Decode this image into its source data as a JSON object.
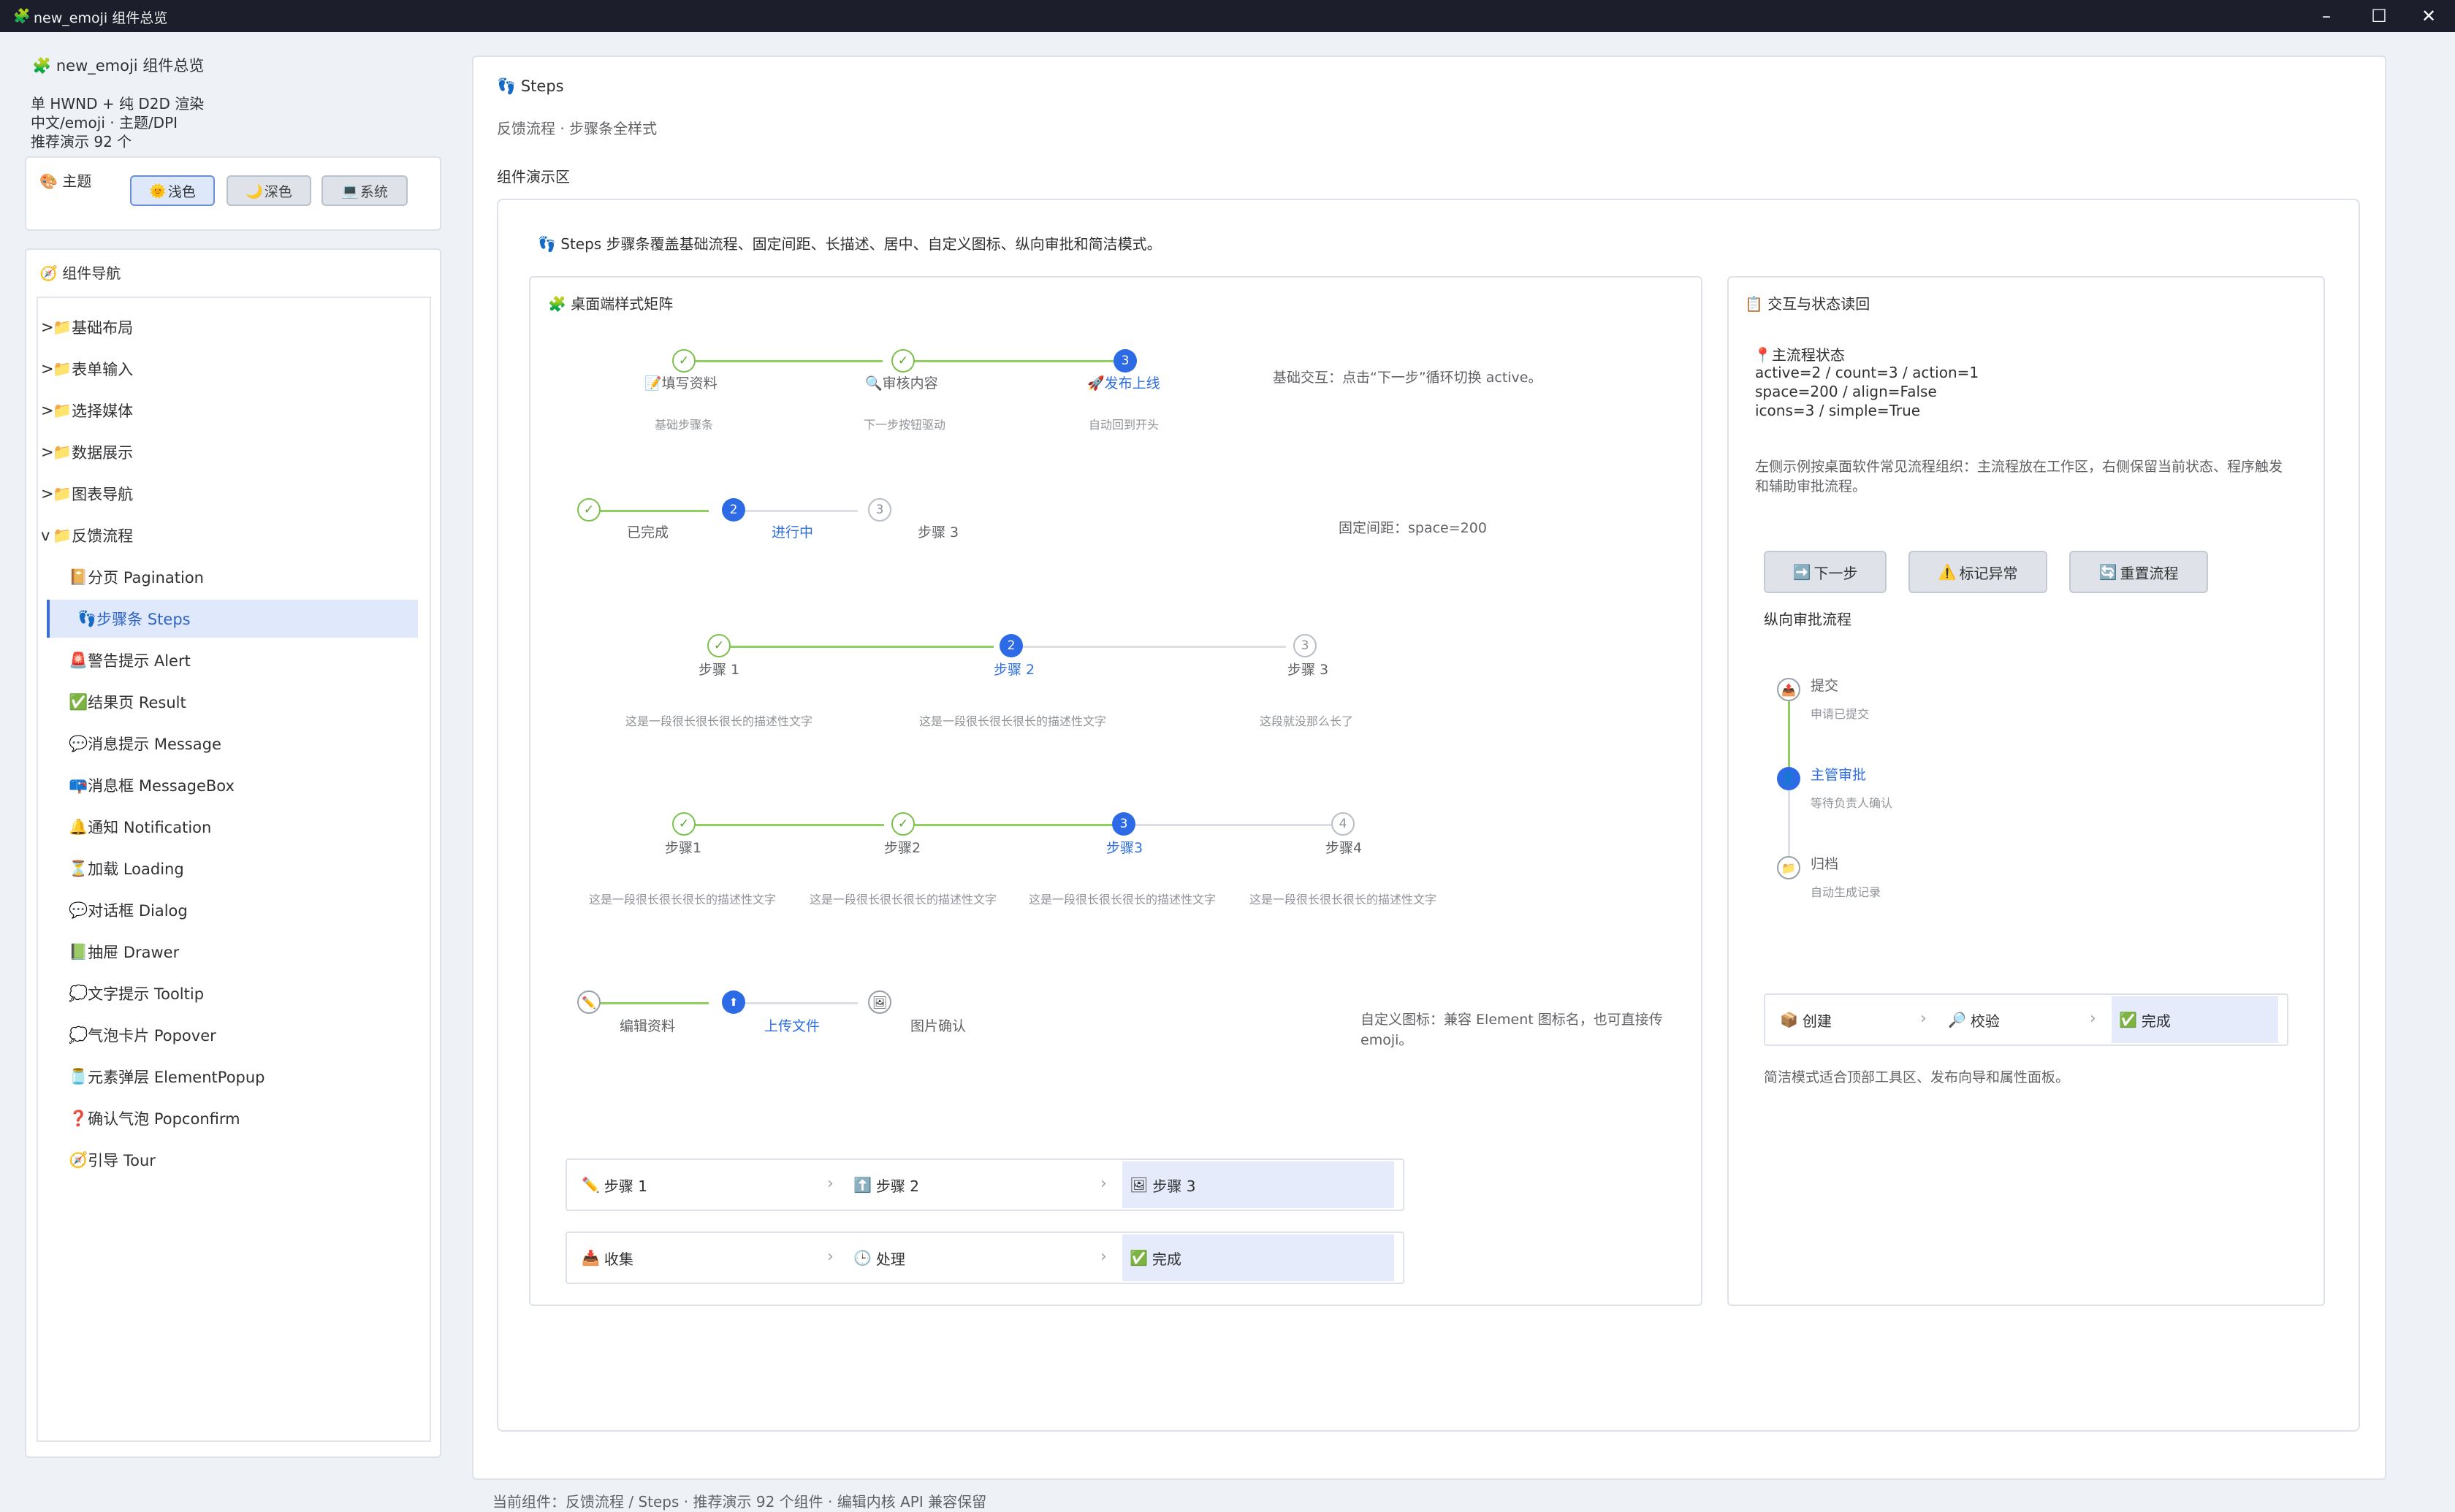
{
  "window": {
    "title": "new_emoji 组件总览",
    "icon": "🧩"
  },
  "sidebar": {
    "app_title": "new_emoji 组件总览",
    "info_lines": [
      "单 HWND + 纯 D2D 渲染",
      "中文/emoji · 主题/DPI",
      "推荐演示 92 个"
    ],
    "theme": {
      "title": "主题",
      "buttons": [
        {
          "icon": "🌞",
          "label": "浅色",
          "active": true
        },
        {
          "icon": "🌙",
          "label": "深色",
          "active": false
        },
        {
          "icon": "💻",
          "label": "系统",
          "active": false
        }
      ]
    },
    "nav": {
      "title": "组件导航",
      "items": [
        {
          "prefix": ">",
          "icon": "📁",
          "label": "基础布局"
        },
        {
          "prefix": ">",
          "icon": "📁",
          "label": "表单输入"
        },
        {
          "prefix": ">",
          "icon": "📁",
          "label": "选择媒体"
        },
        {
          "prefix": ">",
          "icon": "📁",
          "label": "数据展示"
        },
        {
          "prefix": ">",
          "icon": "📁",
          "label": "图表导航"
        },
        {
          "prefix": "v",
          "icon": "📁",
          "label": "反馈流程"
        },
        {
          "prefix": "",
          "icon": "📔",
          "label": "分页 Pagination"
        },
        {
          "prefix": "",
          "icon": "👣",
          "label": "步骤条 Steps",
          "selected": true
        },
        {
          "prefix": "",
          "icon": "🚨",
          "label": "警告提示 Alert"
        },
        {
          "prefix": "",
          "icon": "✅",
          "label": "结果页 Result"
        },
        {
          "prefix": "",
          "icon": "💬",
          "label": "消息提示 Message"
        },
        {
          "prefix": "",
          "icon": "📪",
          "label": "消息框 MessageBox"
        },
        {
          "prefix": "",
          "icon": "🔔",
          "label": "通知 Notification"
        },
        {
          "prefix": "",
          "icon": "⏳",
          "label": "加载 Loading"
        },
        {
          "prefix": "",
          "icon": "💬",
          "label": "对话框 Dialog"
        },
        {
          "prefix": "",
          "icon": "📗",
          "label": "抽屉 Drawer"
        },
        {
          "prefix": "",
          "icon": "💭",
          "label": "文字提示 Tooltip"
        },
        {
          "prefix": "",
          "icon": "💭",
          "label": "气泡卡片 Popover"
        },
        {
          "prefix": "",
          "icon": "🫙",
          "label": "元素弹层 ElementPopup"
        },
        {
          "prefix": "",
          "icon": "❓",
          "label": "确认气泡 Popconfirm"
        },
        {
          "prefix": "",
          "icon": "🧭",
          "label": "引导 Tour"
        }
      ]
    }
  },
  "main": {
    "title_icon": "👣",
    "title": "Steps",
    "subtitle": "反馈流程 · 步骤条全样式",
    "demo_label": "组件演示区",
    "intro": "Steps 步骤条覆盖基础流程、固定间距、长描述、居中、自定义图标、纵向审批和简洁模式。",
    "left_panel": {
      "title": "桌面端样式矩阵",
      "row1": {
        "steps": [
          {
            "icon": "📝",
            "title": "填写资料",
            "desc": "基础步骤条",
            "status": "done"
          },
          {
            "icon": "🔍",
            "title": "审核内容",
            "desc": "下一步按钮驱动",
            "status": "done"
          },
          {
            "icon": "🚀",
            "title": "发布上线",
            "desc": "自动回到开头",
            "status": "current",
            "num": "3"
          }
        ],
        "note": "基础交互：点击“下一步”循环切换 active。"
      },
      "row2": {
        "steps": [
          {
            "title": "已完成",
            "status": "done"
          },
          {
            "title": "进行中",
            "status": "current",
            "num": "2"
          },
          {
            "title": "步骤 3",
            "status": "wait",
            "num": "3"
          }
        ],
        "note": "固定间距：space=200"
      },
      "row3": {
        "steps": [
          {
            "title": "步骤 1",
            "desc": "这是一段很长很长很长的描述性文字",
            "status": "done"
          },
          {
            "title": "步骤 2",
            "desc": "这是一段很长很长很长的描述性文字",
            "status": "current",
            "num": "2"
          },
          {
            "title": "步骤 3",
            "desc": "这段就没那么长了",
            "status": "wait",
            "num": "3"
          }
        ]
      },
      "row4": {
        "steps": [
          {
            "title": "步骤1",
            "desc": "这是一段很长很长很长的描述性文字",
            "status": "done"
          },
          {
            "title": "步骤2",
            "desc": "这是一段很长很长很长的描述性文字",
            "status": "done"
          },
          {
            "title": "步骤3",
            "desc": "这是一段很长很长很长的描述性文字",
            "status": "current",
            "num": "3"
          },
          {
            "title": "步骤4",
            "desc": "这是一段很长很长很长的描述性文字",
            "status": "wait",
            "num": "4"
          }
        ]
      },
      "row5": {
        "steps": [
          {
            "icon": "✏️",
            "title": "编辑资料",
            "status": "done"
          },
          {
            "icon": "⬆",
            "title": "上传文件",
            "status": "current"
          },
          {
            "icon": "🖼",
            "title": "图片确认",
            "status": "wait"
          }
        ],
        "note": "自定义图标：兼容 Element 图标名，也可直接传 emoji。"
      },
      "simple1": [
        {
          "icon": "✏️",
          "label": "步骤 1"
        },
        {
          "icon": "⬆️",
          "label": "步骤 2"
        },
        {
          "icon": "🖼",
          "label": "步骤 3"
        }
      ],
      "simple2": [
        {
          "icon": "📥",
          "label": "收集"
        },
        {
          "icon": "🕒",
          "label": "处理"
        },
        {
          "icon": "✅",
          "label": "完成"
        }
      ]
    },
    "right_panel": {
      "title": "交互与状态读回",
      "status_title": "主流程状态",
      "status_lines": [
        "active=2 / count=3 / action=1",
        "space=200 / align=False",
        "icons=3 / simple=True"
      ],
      "desc": "左侧示例按桌面软件常见流程组织：主流程放在工作区，右侧保留当前状态、程序触发和辅助审批流程。",
      "buttons": [
        {
          "icon": "➡️",
          "label": "下一步"
        },
        {
          "icon": "⚠️",
          "label": "标记异常"
        },
        {
          "icon": "🔄",
          "label": "重置流程"
        }
      ],
      "vertical_title": "纵向审批流程",
      "vertical_steps": [
        {
          "icon": "📤",
          "title": "提交",
          "desc": "申请已提交",
          "status": "done"
        },
        {
          "icon": "👤",
          "title": "主管审批",
          "desc": "等待负责人确认",
          "status": "current"
        },
        {
          "icon": "📁",
          "title": "归档",
          "desc": "自动生成记录",
          "status": "wait"
        }
      ],
      "simple": [
        {
          "icon": "📦",
          "label": "创建"
        },
        {
          "icon": "🔎",
          "label": "校验"
        },
        {
          "icon": "✅",
          "label": "完成"
        }
      ],
      "simple_note": "简洁模式适合顶部工具区、发布向导和属性面板。"
    }
  },
  "status_bar": "当前组件：反馈流程 / Steps · 推荐演示 92 个组件 · 编辑内核 API 兼容保留",
  "colors": {
    "accent": "#2d6be6",
    "done": "#7cc04f",
    "wait": "#b8bdc6"
  }
}
